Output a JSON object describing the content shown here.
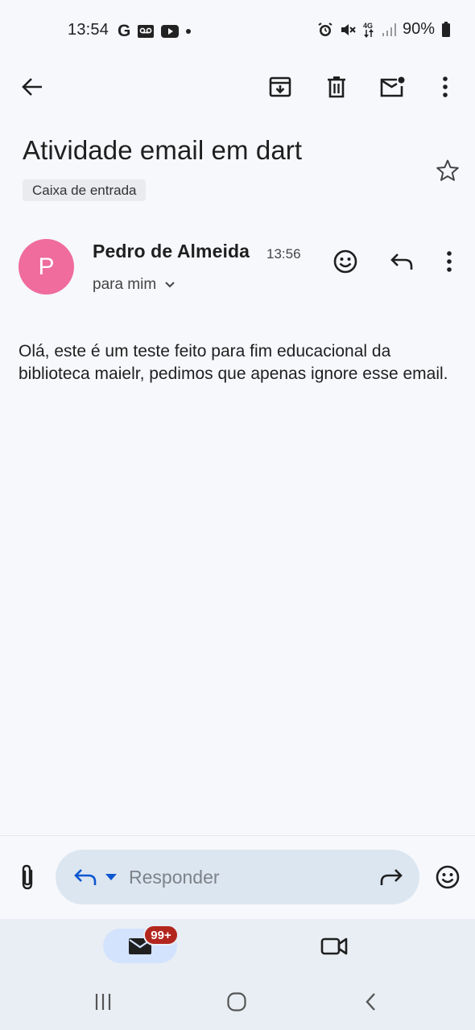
{
  "status_bar": {
    "time": "13:54",
    "left_icons": [
      "google-icon",
      "voicemail-icon",
      "youtube-icon",
      "dot-icon"
    ],
    "right_icons": [
      "alarm-icon",
      "mute-icon",
      "network-4g-icon",
      "signal-icon"
    ],
    "battery": "90%"
  },
  "toolbar": {
    "icons": [
      "back-arrow-icon",
      "archive-icon",
      "delete-icon",
      "mark-unread-icon",
      "more-vert-icon"
    ]
  },
  "email": {
    "subject": "Atividade email em dart",
    "label": "Caixa de entrada",
    "sender": {
      "initial": "P",
      "name": "Pedro de Almeida",
      "time": "13:56",
      "recipient": "para mim",
      "avatar_color": "#ef6c9d"
    },
    "body": "Olá, este é um teste feito para fim educacional da biblioteca maielr, pedimos que apenas ignore esse email."
  },
  "reply_bar": {
    "placeholder": "Responder"
  },
  "bottom_nav": {
    "mail_badge": "99+",
    "accent": "#d3e3fd",
    "badge_color": "#b3261e"
  },
  "colors": {
    "background": "#f6f8fc",
    "reply_box": "#dce6f0",
    "bottom_nav": "#e9eef4"
  }
}
